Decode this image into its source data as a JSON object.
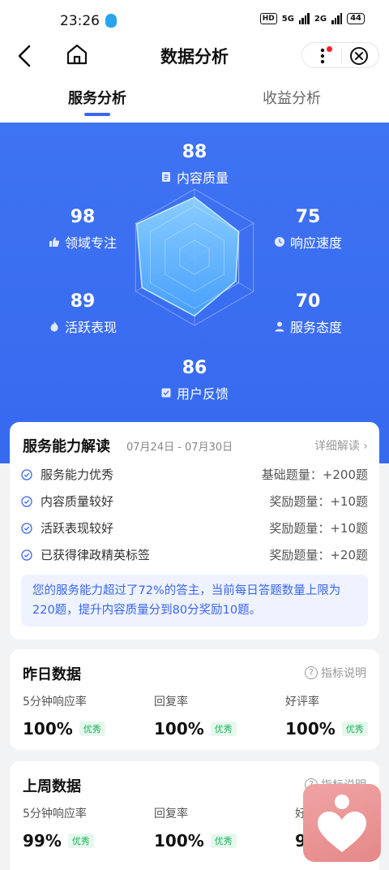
{
  "status": {
    "time": "23:26",
    "hd": "HD",
    "net1": "5G",
    "net2": "2G",
    "battery": "44"
  },
  "nav": {
    "title": "数据分析"
  },
  "tabs": [
    {
      "label": "服务分析"
    },
    {
      "label": "收益分析"
    }
  ],
  "radar": {
    "max": 100,
    "metrics": [
      {
        "name": "内容质量",
        "value": "88",
        "icon": "document-icon"
      },
      {
        "name": "响应速度",
        "value": "75",
        "icon": "clock-icon"
      },
      {
        "name": "服务态度",
        "value": "70",
        "icon": "person-icon"
      },
      {
        "name": "用户反馈",
        "value": "86",
        "icon": "feedback-icon"
      },
      {
        "name": "活跃表现",
        "value": "89",
        "icon": "flame-icon"
      },
      {
        "name": "领域专注",
        "value": "98",
        "icon": "thumb-up-icon"
      }
    ]
  },
  "ability": {
    "title": "服务能力解读",
    "range": "07月24日 - 07月30日",
    "detail_link": "详细解读",
    "items": [
      {
        "text": "服务能力优秀",
        "reward": "基础题量：+200题"
      },
      {
        "text": "内容质量较好",
        "reward": "奖励题量：+10题"
      },
      {
        "text": "活跃表现较好",
        "reward": "奖励题量：+10题"
      },
      {
        "text": "已获得律政精英标签",
        "reward": "奖励题量：+20题"
      }
    ],
    "tip": "您的服务能力超过了72%的答主，当前每日答题数量上限为220题，提升内容质量分到80分奖励10题。"
  },
  "yesterday": {
    "title": "昨日数据",
    "help": "指标说明",
    "stats": [
      {
        "label": "5分钟响应率",
        "value": "100%",
        "badge": "优秀"
      },
      {
        "label": "回复率",
        "value": "100%",
        "badge": "优秀"
      },
      {
        "label": "好评率",
        "value": "100%",
        "badge": "优秀"
      }
    ]
  },
  "lastweek": {
    "title": "上周数据",
    "help": "指标说明",
    "stats": [
      {
        "label": "5分钟响应率",
        "value": "99%",
        "badge": "优秀"
      },
      {
        "label": "回复率",
        "value": "100%",
        "badge": "优秀"
      },
      {
        "label": "好",
        "value": "9",
        "badge": ""
      }
    ]
  },
  "colors": {
    "primary": "#3a66f0",
    "hero": "#3e73f2",
    "success": "#16b157"
  }
}
